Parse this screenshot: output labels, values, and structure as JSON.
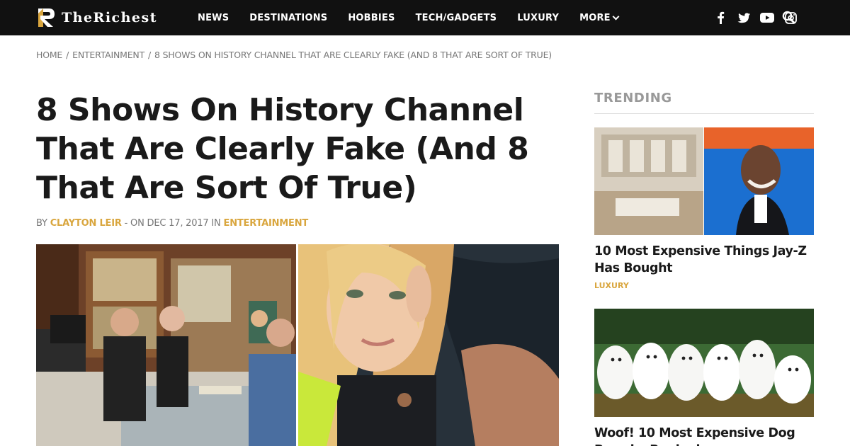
{
  "brand": {
    "name": "TheRichest",
    "logo_text": "TheRichest",
    "accent_color": "#d9a63e"
  },
  "nav": {
    "items": [
      {
        "label": "NEWS"
      },
      {
        "label": "DESTINATIONS"
      },
      {
        "label": "HOBBIES"
      },
      {
        "label": "TECH/GADGETS"
      },
      {
        "label": "LUXURY"
      },
      {
        "label": "MORE"
      }
    ],
    "social_icons": [
      "facebook-icon",
      "twitter-icon",
      "youtube-icon",
      "instagram-icon"
    ],
    "search_icon": "search-icon"
  },
  "breadcrumb": {
    "items": [
      "Home",
      "Entertainment",
      "8 Shows On History Channel That Are Clearly Fake (And 8 That Are Sort Of True)"
    ],
    "separator": "/"
  },
  "article": {
    "title": "8 Shows On History Channel That Are Clearly Fake (And 8 That Are Sort Of True)",
    "by_label": "BY",
    "author": "Clayton Leir",
    "on_label": "- ON",
    "date": "DEC 17, 2017",
    "in_label": "IN",
    "category": "Entertainment"
  },
  "sidebar": {
    "heading": "TRENDING",
    "cards": [
      {
        "title": "10 Most Expensive Things Jay-Z Has Bought",
        "category": "Luxury"
      },
      {
        "title": "Woof! 10 Most Expensive Dog Breeds, Ranked",
        "category": ""
      }
    ]
  }
}
